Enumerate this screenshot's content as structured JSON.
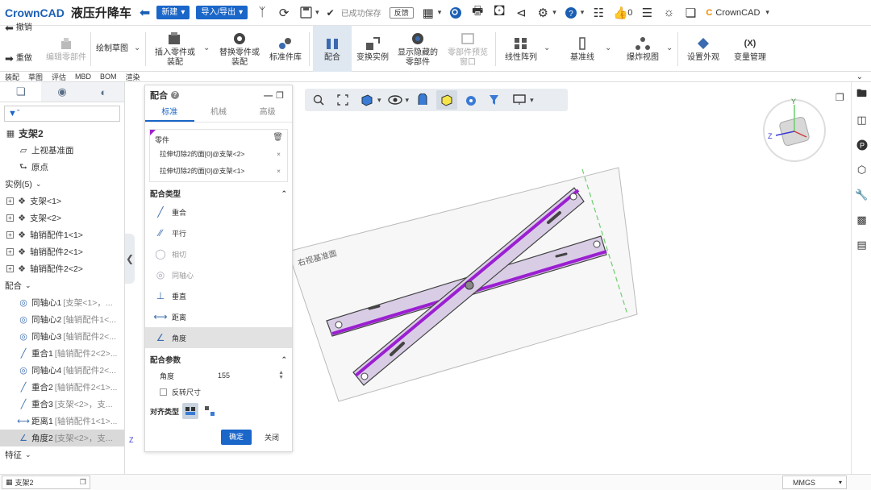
{
  "app": {
    "logo_text": "CrownCAD",
    "title": "液压升降车",
    "new_label": "新建",
    "import_export_label": "导入/导出",
    "saved_status": "已成功保存",
    "feedback_label": "反馈",
    "like_count": "0",
    "brand_right": "CrownCAD"
  },
  "ribbon": {
    "undo": "撤销",
    "redo": "重做",
    "edit_part": "编辑零部件",
    "sketch": "绘制草图",
    "insert_part": "插入零件或装配",
    "replace_part": "替换零件或装配",
    "std_lib": "标准件库",
    "mate": "配合",
    "transform": "变换实例",
    "show_hide": "显示隐藏的零部件",
    "preview": "零部件预览窗口",
    "linear_array": "线性阵列",
    "baseline": "基准线",
    "explode": "爆炸视图",
    "appearance": "设置外观",
    "var_mgmt": "变量管理",
    "var_icon": "(X)"
  },
  "tabs": [
    "装配",
    "草图",
    "评估",
    "MBD",
    "BOM",
    "渲染"
  ],
  "tree": {
    "root": "支架2",
    "top_plane": "上视基准面",
    "origin": "原点",
    "instances_header": "实例(5)",
    "instances": [
      "支架<1>",
      "支架<2>",
      "轴销配件1<1>",
      "轴销配件2<1>",
      "轴销配件2<2>"
    ],
    "mates_header": "配合",
    "mates": [
      {
        "name": "同轴心1",
        "detail": "[支架<1>，..."
      },
      {
        "name": "同轴心2",
        "detail": "[轴销配件1<..."
      },
      {
        "name": "同轴心3",
        "detail": "[轴销配件2<..."
      },
      {
        "name": "重合1",
        "detail": "[轴销配件2<2>..."
      },
      {
        "name": "同轴心4",
        "detail": "[轴销配件2<..."
      },
      {
        "name": "重合2",
        "detail": "[轴销配件2<1>..."
      },
      {
        "name": "重合3",
        "detail": "[支架<2>，支..."
      },
      {
        "name": "距离1",
        "detail": "[轴销配件1<1>..."
      },
      {
        "name": "角度2",
        "detail": "[支架<2>，支..."
      }
    ],
    "features_header": "特征"
  },
  "dialog": {
    "title": "配合",
    "tabs": [
      "标准",
      "机械",
      "高级"
    ],
    "parts_label": "零件",
    "parts": [
      "拉伸切除2的面[0]@支架<2>",
      "拉伸切除2的面[0]@支架<1>"
    ],
    "mate_type_header": "配合类型",
    "mate_types": [
      "重合",
      "平行",
      "相切",
      "同轴心",
      "垂直",
      "距离",
      "角度"
    ],
    "params_header": "配合参数",
    "angle_label": "角度",
    "angle_value": "155",
    "flip_label": "反转尺寸",
    "align_label": "对齐类型",
    "ok": "确定",
    "close": "关闭"
  },
  "viewport": {
    "plane_label": "右视基准面",
    "triad_y": "Y",
    "triad_z": "Z",
    "corner_z": "Z"
  },
  "status": {
    "doc_tab": "支架2",
    "units": "MMGS"
  },
  "colors": {
    "brand_blue": "#1a66c9",
    "highlight_purple": "#9b1fd1",
    "part_fill": "#d9cde6"
  }
}
